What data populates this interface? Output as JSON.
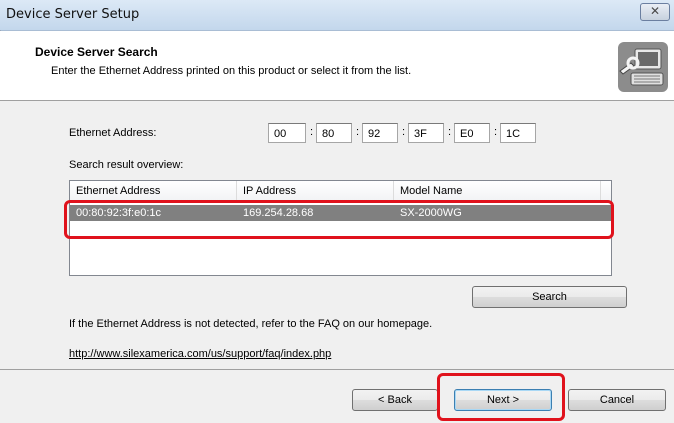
{
  "window": {
    "title": "Device Server Setup",
    "close_glyph": "✕"
  },
  "header": {
    "title": "Device Server Search",
    "subtitle": "Enter the Ethernet Address printed on this product or select it from the list.",
    "icon": "computer-wrench-icon"
  },
  "form": {
    "ethernet_label": "Ethernet Address:",
    "mac_fields": [
      "00",
      "80",
      "92",
      "3F",
      "E0",
      "1C"
    ],
    "separator": ":",
    "search_result_label": "Search result overview:"
  },
  "results": {
    "columns": [
      "Ethernet Address",
      "IP Address",
      "Model Name"
    ],
    "rows": [
      {
        "ethernet": "00:80:92:3f:e0:1c",
        "ip": "169.254.28.68",
        "model": "SX-2000WG"
      }
    ]
  },
  "search_button": "Search",
  "info_text": "If the Ethernet Address is not detected, refer to the FAQ on our homepage.",
  "faq_link": "http://www.silexamerica.com/us/support/faq/index.php",
  "footer": {
    "back": "< Back",
    "next": "Next >",
    "cancel": "Cancel"
  },
  "colors": {
    "selection": "#808080",
    "highlight": "#e0121c"
  }
}
